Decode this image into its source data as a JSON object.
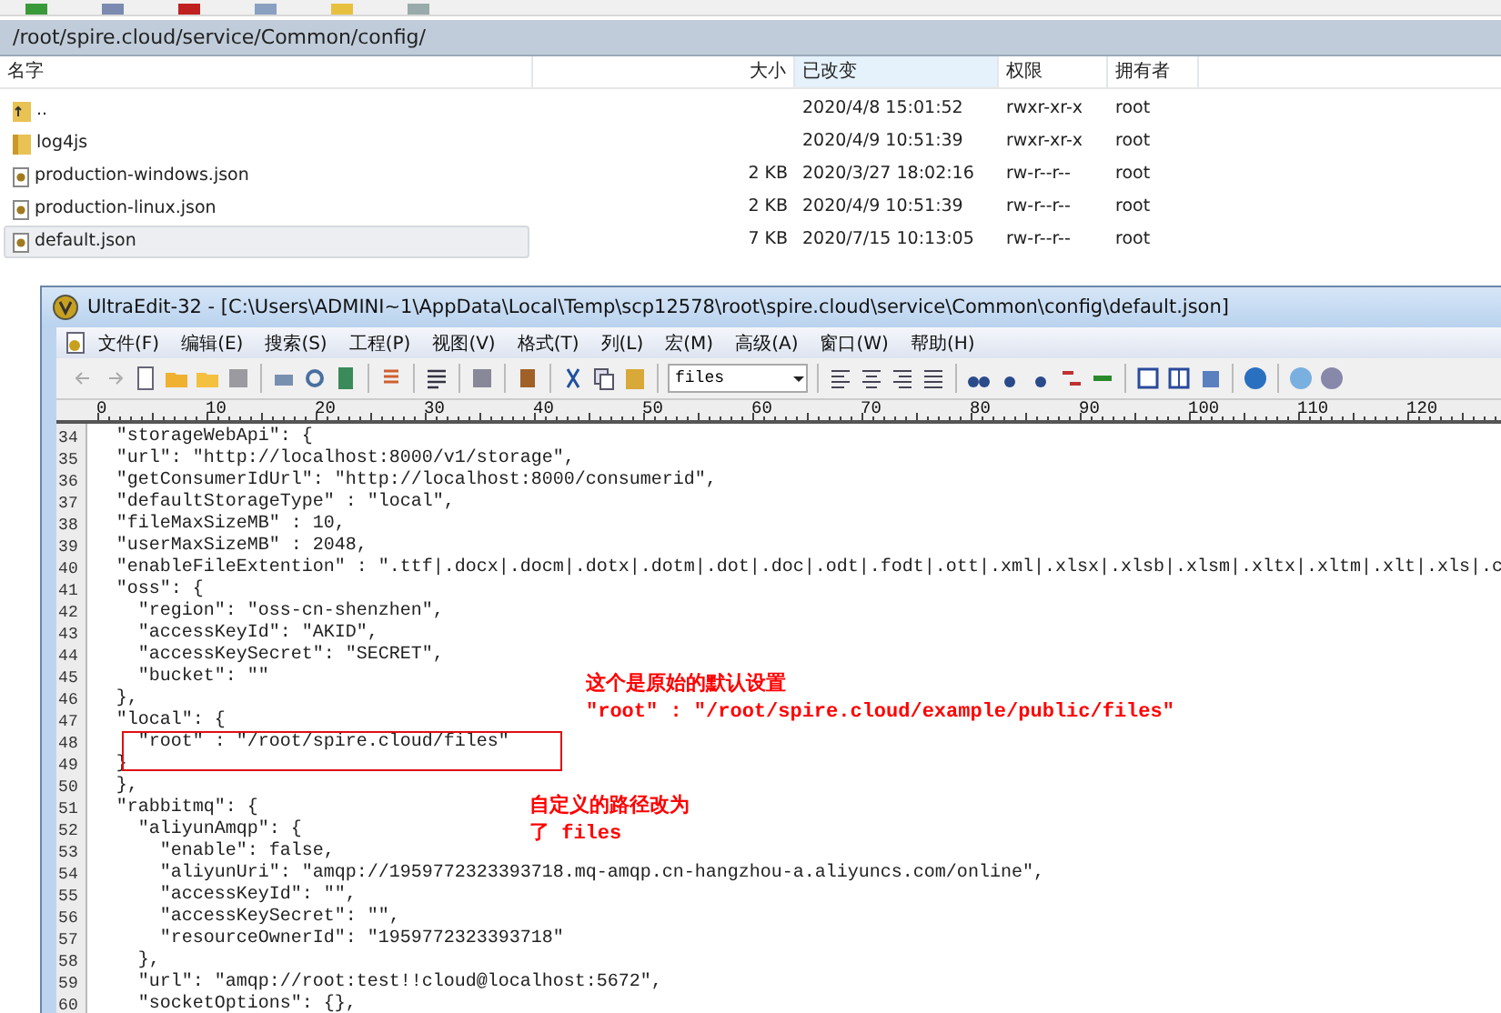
{
  "file_browser": {
    "path": "/root/spire.cloud/service/Common/config/",
    "columns": [
      {
        "label": "名字",
        "sorted": false
      },
      {
        "label": "大小",
        "sorted": false
      },
      {
        "label": "已改变",
        "sorted": true
      },
      {
        "label": "权限",
        "sorted": false
      },
      {
        "label": "拥有者",
        "sorted": false
      }
    ],
    "rows": [
      {
        "kind": "parent",
        "name": "..",
        "size": "",
        "modified": "2020/4/8 15:01:52",
        "permissions": "rwxr-xr-x",
        "owner": "root",
        "selected": false
      },
      {
        "kind": "folder",
        "name": "log4js",
        "size": "",
        "modified": "2020/4/9 10:51:39",
        "permissions": "rwxr-xr-x",
        "owner": "root",
        "selected": false
      },
      {
        "kind": "file",
        "name": "production-windows.json",
        "size": "2 KB",
        "modified": "2020/3/27 18:02:16",
        "permissions": "rw-r--r--",
        "owner": "root",
        "selected": false
      },
      {
        "kind": "file",
        "name": "production-linux.json",
        "size": "2 KB",
        "modified": "2020/4/9 10:51:39",
        "permissions": "rw-r--r--",
        "owner": "root",
        "selected": false
      },
      {
        "kind": "file",
        "name": "default.json",
        "size": "7 KB",
        "modified": "2020/7/15 10:13:05",
        "permissions": "rw-r--r--",
        "owner": "root",
        "selected": true
      }
    ]
  },
  "editor": {
    "title": "UltraEdit-32 - [C:\\Users\\ADMINI~1\\AppData\\Local\\Temp\\scp12578\\root\\spire.cloud\\service\\Common\\config\\default.json]",
    "menu": [
      "文件(F)",
      "编辑(E)",
      "搜索(S)",
      "工程(P)",
      "视图(V)",
      "格式(T)",
      "列(L)",
      "宏(M)",
      "高级(A)",
      "窗口(W)",
      "帮助(H)"
    ],
    "search_combo": {
      "value": "files"
    },
    "ruler": [
      "0",
      "10",
      "20",
      "30",
      "40",
      "50",
      "60",
      "70",
      "80",
      "90",
      "100",
      "110",
      "120"
    ],
    "lines": [
      {
        "number": "34",
        "code": "  \"storageWebApi\": {"
      },
      {
        "number": "35",
        "code": "  \"url\": \"http://localhost:8000/v1/storage\","
      },
      {
        "number": "36",
        "code": "  \"getConsumerIdUrl\": \"http://localhost:8000/consumerid\","
      },
      {
        "number": "37",
        "code": "  \"defaultStorageType\" : \"local\","
      },
      {
        "number": "38",
        "code": "  \"fileMaxSizeMB\" : 10,"
      },
      {
        "number": "39",
        "code": "  \"userMaxSizeMB\" : 2048,"
      },
      {
        "number": "40",
        "code": "  \"enableFileExtention\" : \".ttf|.docx|.docm|.dotx|.dotm|.dot|.doc|.odt|.fodt|.ott|.xml|.xlsx|.xlsb|.xlsm|.xltx|.xltm|.xlt|.xls|.c"
      },
      {
        "number": "41",
        "code": "  \"oss\": {"
      },
      {
        "number": "42",
        "code": "    \"region\": \"oss-cn-shenzhen\","
      },
      {
        "number": "43",
        "code": "    \"accessKeyId\": \"AKID\","
      },
      {
        "number": "44",
        "code": "    \"accessKeySecret\": \"SECRET\","
      },
      {
        "number": "45",
        "code": "    \"bucket\": \"\""
      },
      {
        "number": "46",
        "code": "  },"
      },
      {
        "number": "47",
        "code": "  \"local\": {"
      },
      {
        "number": "48",
        "code": "    \"root\" : \"/root/spire.cloud/files\""
      },
      {
        "number": "49",
        "code": "  }"
      },
      {
        "number": "50",
        "code": "  },"
      },
      {
        "number": "51",
        "code": "  \"rabbitmq\": {"
      },
      {
        "number": "52",
        "code": "    \"aliyunAmqp\": {"
      },
      {
        "number": "53",
        "code": "      \"enable\": false,"
      },
      {
        "number": "54",
        "code": "      \"aliyunUri\": \"amqp://1959772323393718.mq-amqp.cn-hangzhou-a.aliyuncs.com/online\","
      },
      {
        "number": "55",
        "code": "      \"accessKeyId\": \"\","
      },
      {
        "number": "56",
        "code": "      \"accessKeySecret\": \"\","
      },
      {
        "number": "57",
        "code": "      \"resourceOwnerId\": \"1959772323393718\""
      },
      {
        "number": "58",
        "code": "    },"
      },
      {
        "number": "59",
        "code": "    \"url\": \"amqp://root:test!!cloud@localhost:5672\","
      },
      {
        "number": "60",
        "code": "    \"socketOptions\": {},"
      }
    ],
    "annotations": [
      {
        "lines": [
          "这个是原始的默认设置",
          "\"root\" : \"/root/spire.cloud/example/public/files\""
        ]
      },
      {
        "lines": [
          "自定义的路径改为",
          "了 files"
        ]
      }
    ]
  }
}
